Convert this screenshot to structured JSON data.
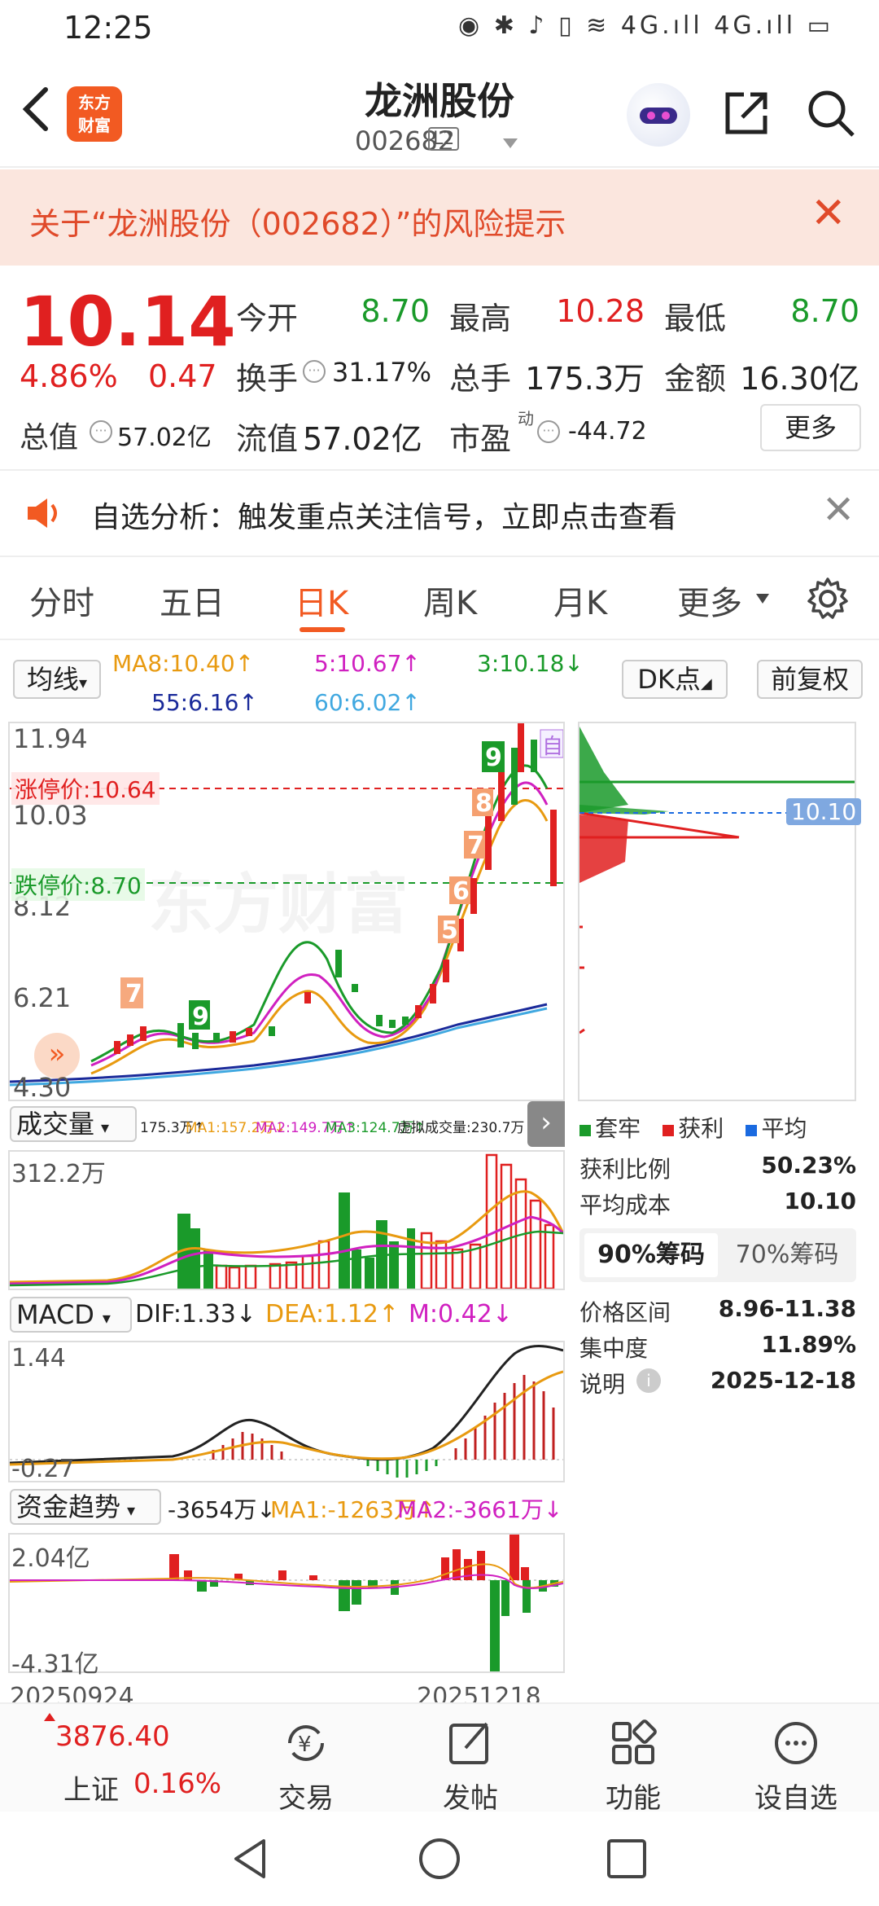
{
  "status": {
    "time": "12:25",
    "icons": "◉ ✱ ♪ ▯ ≋ 4G.ıll 4G.ıll ▭"
  },
  "header": {
    "title": "龙洲股份",
    "code": "002682",
    "level": "L2"
  },
  "risk": {
    "text": "关于“龙洲股份（002682）”的风险提示"
  },
  "quote": {
    "price": "10.14",
    "pct": "4.86%",
    "change": "0.47",
    "open_label": "今开",
    "open": "8.70",
    "high_label": "最高",
    "high": "10.28",
    "low_label": "最低",
    "low": "8.70",
    "turnover_label": "换手",
    "turnover": "31.17%",
    "volume_label": "总手",
    "volume": "175.3万",
    "amount_label": "金额",
    "amount": "16.30亿",
    "mktcap_label": "总值",
    "mktcap": "57.02亿",
    "float_label": "流值",
    "float": "57.02亿",
    "pe_label": "市盈",
    "pe_sup": "动",
    "pe": "-44.72",
    "more": "更多"
  },
  "notice": {
    "text": "自选分析：触发重点关注信号，立即点击查看"
  },
  "tabs": [
    "分时",
    "五日",
    "日K",
    "周K",
    "月K",
    "更多"
  ],
  "kline": {
    "ma_btn": "均线",
    "ma8": "MA8:10.40↑",
    "ma5": "5:10.67↑",
    "ma3": "3:10.18↓",
    "ma55": "55:6.16↑",
    "ma60": "60:6.02↑",
    "dk_btn": "DK点",
    "fq_btn": "前复权",
    "y_top": "11.94",
    "y2": "10.03",
    "y3": "8.12",
    "y4": "6.21",
    "y_bot": "4.30",
    "limit_up": "涨停价:10.64",
    "limit_down": "跌停价:8.70",
    "self_tag": "自"
  },
  "volume": {
    "btn": "成交量",
    "v": "175.3万↑",
    "ma1": "MA1:157.2万↓",
    "ma2": "MA2:149.7万↑",
    "ma3": "MA3:124.7万↑",
    "virtual": "虚拟成交量:230.7万",
    "y_top": "312.2万"
  },
  "macd": {
    "btn": "MACD",
    "dif": "DIF:1.33↓",
    "dea": "DEA:1.12↑",
    "m": "M:0.42↓",
    "y_top": "1.44",
    "y_bot": "-0.27"
  },
  "fund": {
    "btn": "资金趋势",
    "v": "-3654万↓",
    "ma1": "MA1:-1263万↑",
    "ma2": "MA2:-3661万↓",
    "y_top": "2.04亿",
    "y_bot": "-4.31亿"
  },
  "dates": {
    "start": "20250924",
    "end": "20251218"
  },
  "chips": {
    "price_tag": "10.10",
    "legend_trap": "套牢",
    "legend_profit": "获利",
    "legend_avg": "平均",
    "profit_ratio_label": "获利比例",
    "profit_ratio": "50.23%",
    "avg_cost_label": "平均成本",
    "avg_cost": "10.10",
    "tab90": "90%筹码",
    "tab70": "70%筹码",
    "range_label": "价格区间",
    "range": "8.96-11.38",
    "conc_label": "集中度",
    "conc": "11.89%",
    "note_label": "说明",
    "note_date": "2025-12-18"
  },
  "bottom": {
    "index_value": "3876.40",
    "index_name": "上证",
    "index_pct": "0.16%",
    "trade": "交易",
    "post": "发帖",
    "func": "功能",
    "fav": "设自选"
  },
  "colors": {
    "accent": "#f25a22",
    "up": "#e02020",
    "down": "#1a9a2a"
  }
}
